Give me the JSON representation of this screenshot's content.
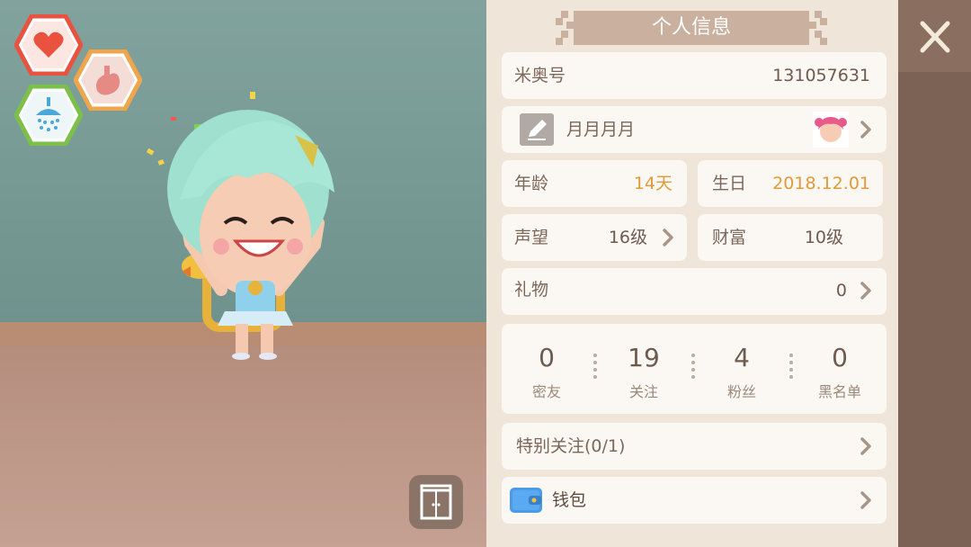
{
  "panel": {
    "title": "个人信息",
    "id_label": "米奥号",
    "id_value": "131057631",
    "nickname": "月月月月",
    "age_label": "年龄",
    "age_value": "14天",
    "birthday_label": "生日",
    "birthday_value": "2018.12.01",
    "reputation_label": "声望",
    "reputation_value": "16级",
    "wealth_label": "财富",
    "wealth_value": "10级",
    "gifts_label": "礼物",
    "gifts_value": "0",
    "stats": [
      {
        "label": "密友",
        "value": "0"
      },
      {
        "label": "关注",
        "value": "19"
      },
      {
        "label": "粉丝",
        "value": "4"
      },
      {
        "label": "黑名单",
        "value": "0"
      }
    ],
    "special_follow": "特别关注(0/1)",
    "wallet": "钱包"
  },
  "status_icons": [
    "heart-icon",
    "stomach-icon",
    "shower-icon"
  ],
  "colors": {
    "panel_bg": "#efe6d9",
    "card_bg": "#fbf8f3",
    "accent_orange": "#e09a38",
    "heart_hex": "#e8523f",
    "stomach_hex": "#f0a54a",
    "shower_hex": "#7cc04a",
    "side_strip": "#7b6254"
  }
}
